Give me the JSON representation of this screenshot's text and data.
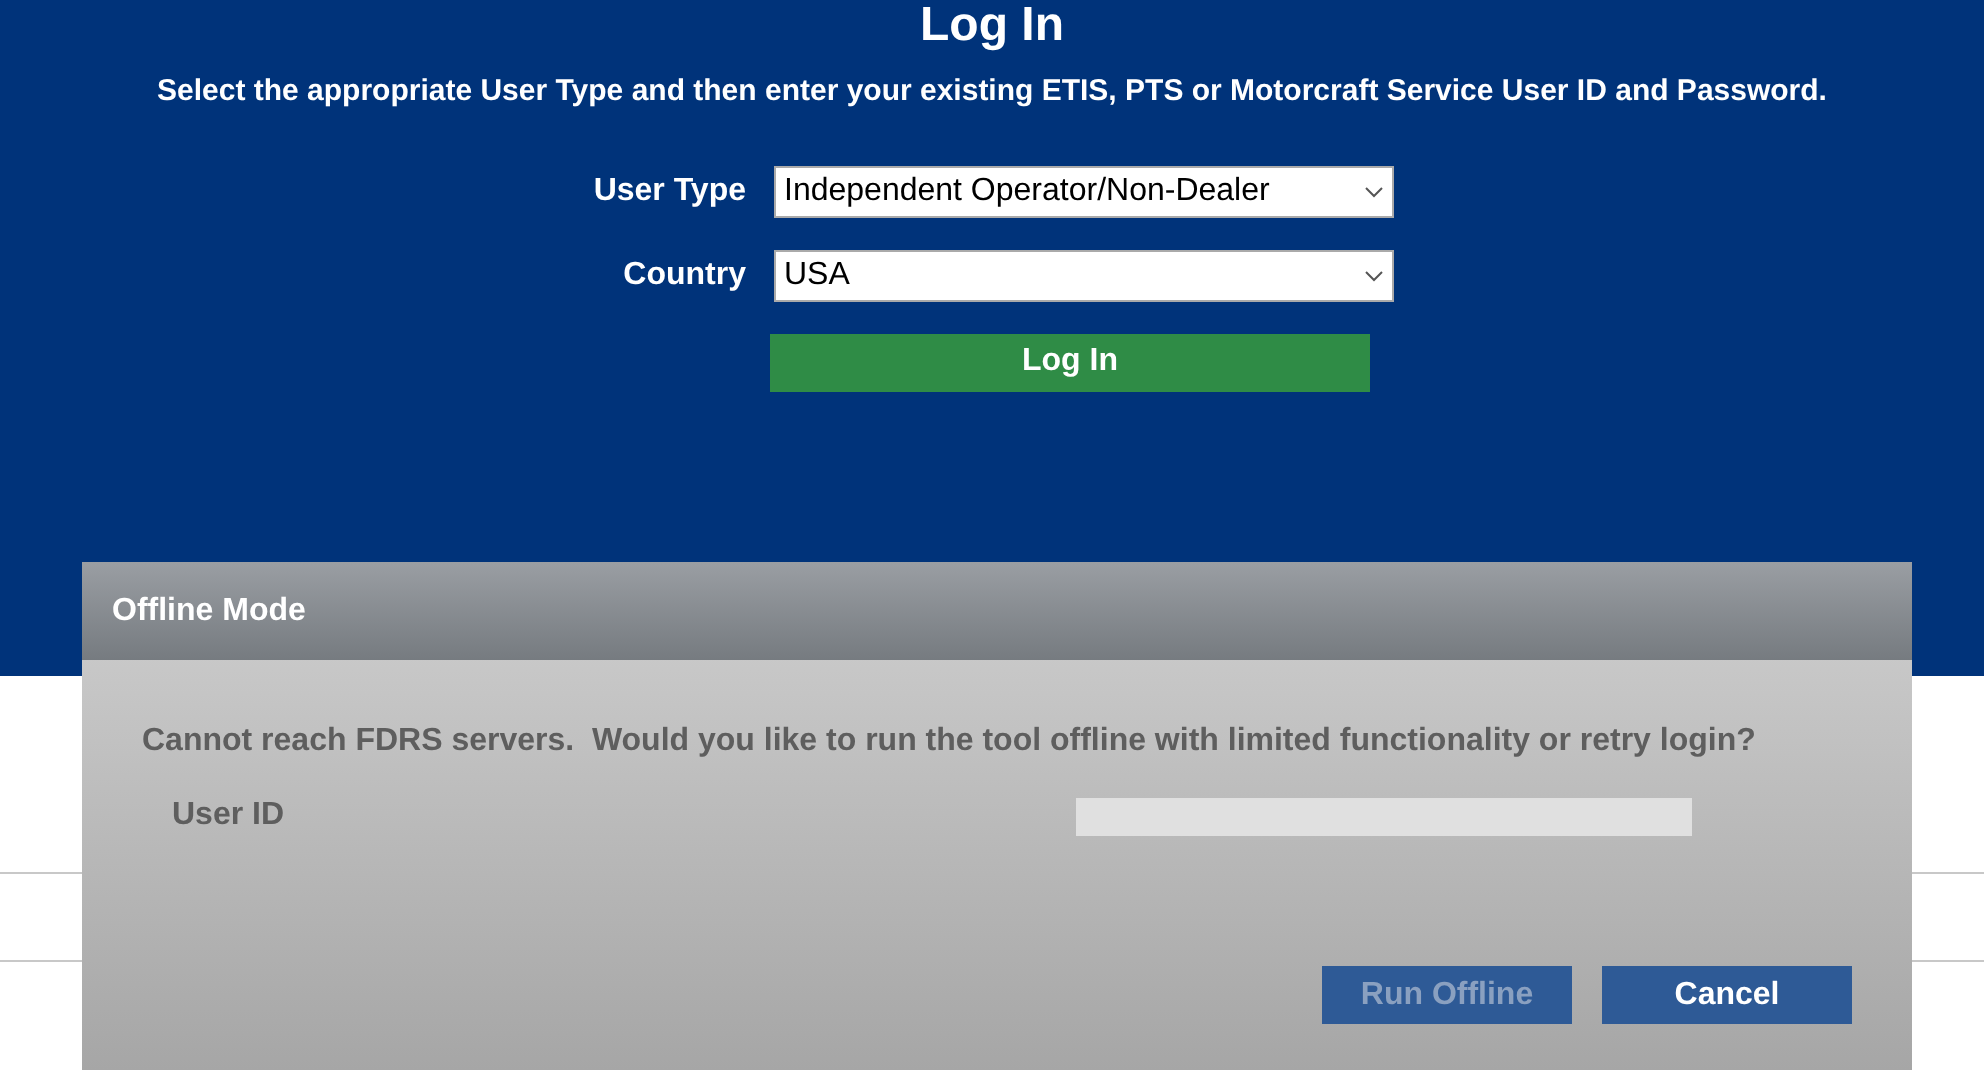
{
  "page": {
    "title": "Log In",
    "instructions": "Select the appropriate User Type and then enter your existing ETIS, PTS or Motorcraft Service User ID and Password.",
    "fields": [
      {
        "label": "User Type",
        "value": "Independent Operator/Non-Dealer"
      },
      {
        "label": "Country",
        "value": "USA"
      }
    ],
    "login_button": "Log In"
  },
  "dialog": {
    "title": "Offline Mode",
    "message": "Cannot reach FDRS servers.  Would you like to run the tool offline with limited functionality or retry login?",
    "field_label": "User ID",
    "buttons": [
      {
        "label": "Run Offline",
        "disabled": true
      },
      {
        "label": "Cancel",
        "disabled": false
      }
    ]
  }
}
